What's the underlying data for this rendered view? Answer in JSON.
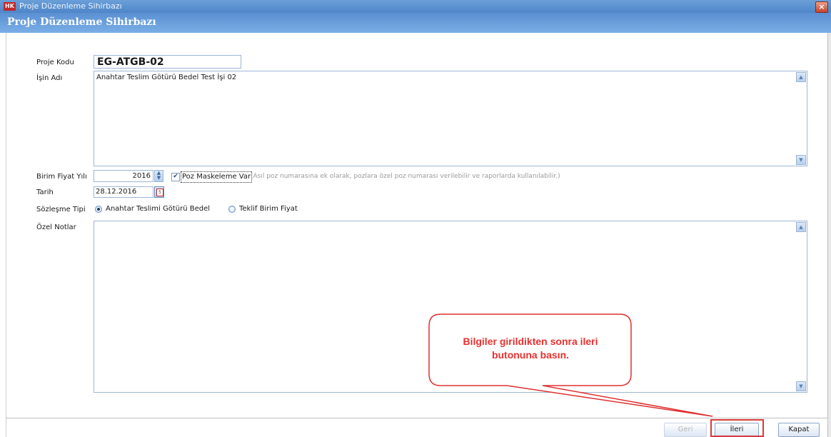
{
  "window": {
    "app_icon": "HK",
    "title": "Proje Düzenleme Sihirbazı",
    "close_glyph": "×"
  },
  "header": {
    "title": "Proje Düzenleme Sihirbazı"
  },
  "form": {
    "proje_kodu": {
      "label": "Proje Kodu",
      "value": "EG-ATGB-02"
    },
    "isin_adi": {
      "label": "İşin Adı",
      "value": "Anahtar Teslim Götürü Bedel Test İşi 02"
    },
    "birim_fiyat_yili": {
      "label": "Birim Fiyat Yılı",
      "value": "2016"
    },
    "poz_maskeleme": {
      "label": "Poz Maskeleme Var",
      "checked": true,
      "hint": "(Asıl poz numarasına ek olarak, pozlara özel poz numarası verilebilir ve raporlarda kullanılabilir.)"
    },
    "tarih": {
      "label": "Tarih",
      "value": "28.12.2016"
    },
    "sozlesme_tipi": {
      "label": "Sözleşme Tipi",
      "options": [
        {
          "label": "Anahtar Teslimi Götürü Bedel",
          "selected": true
        },
        {
          "label": "Teklif Birim Fiyat",
          "selected": false
        }
      ]
    },
    "ozel_notlar": {
      "label": "Özel Notlar",
      "value": ""
    }
  },
  "footer": {
    "geri_label": "Geri",
    "ileri_label": "İleri",
    "kapat_label": "Kapat"
  },
  "callout": {
    "line1": "Bilgiler girildikten sonra ileri",
    "line2": "butonuna basın."
  },
  "colors": {
    "header_blue": "#5a90d2",
    "callout_red": "#e8302f"
  }
}
